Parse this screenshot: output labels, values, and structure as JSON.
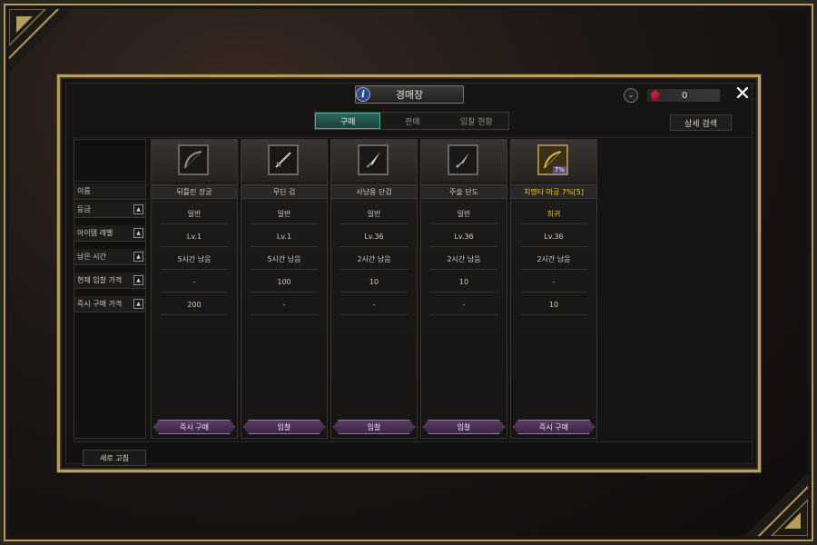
{
  "window": {
    "title": "경매장"
  },
  "currency": {
    "amount": "0"
  },
  "tabs": [
    {
      "label": "구매",
      "active": true
    },
    {
      "label": "판매",
      "active": false
    },
    {
      "label": "입찰 현황",
      "active": false
    }
  ],
  "detail_search_label": "상세 검색",
  "row_labels": [
    "이름",
    "등급",
    "아이템 레벨",
    "남은 시간",
    "현재 입찰 가격",
    "즉시 구매 가격"
  ],
  "items": [
    {
      "name": "뒤틀린 장궁",
      "grade": "일반",
      "level": "Lv.1",
      "time": "5시간 남음",
      "bid": "-",
      "buyout": "200",
      "button": "즉시 구매",
      "icon": "longbow-icon",
      "highlight": false
    },
    {
      "name": "무딘 검",
      "grade": "일반",
      "level": "Lv.1",
      "time": "5시간 남음",
      "bid": "100",
      "buyout": "-",
      "button": "입찰",
      "icon": "sword-icon",
      "highlight": false
    },
    {
      "name": "사냥용 단검",
      "grade": "일반",
      "level": "Lv.36",
      "time": "2시간 남음",
      "bid": "10",
      "buyout": "-",
      "button": "입찰",
      "icon": "dagger-icon",
      "highlight": false
    },
    {
      "name": "주술 단도",
      "grade": "일반",
      "level": "Lv.36",
      "time": "2시간 남음",
      "bid": "10",
      "buyout": "-",
      "button": "입찰",
      "icon": "dagger-icon",
      "highlight": false
    },
    {
      "name": "치명타 마궁 7%[5]",
      "grade": "희귀",
      "level": "Lv.36",
      "time": "2시간 남음",
      "bid": "-",
      "buyout": "10",
      "button": "즉시 구매",
      "icon": "magic-bow-icon",
      "highlight": true,
      "badge": "7%"
    }
  ],
  "refresh_label": "새로 고침",
  "colors": {
    "accent_gold": "#b99d63",
    "tab_active": "#2c6660",
    "buy_button": "#5a3b66",
    "rare_text": "#f0c23e"
  }
}
